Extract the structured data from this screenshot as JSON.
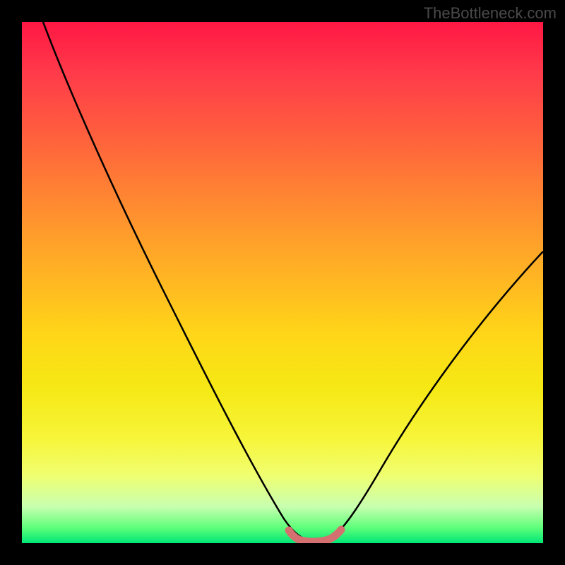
{
  "watermark": "TheBottleneck.com",
  "chart_data": {
    "type": "line",
    "title": "",
    "xlabel": "",
    "ylabel": "",
    "xlim": [
      0,
      100
    ],
    "ylim": [
      0,
      100
    ],
    "background_gradient": {
      "top": "#ff1744",
      "middle": "#ffd618",
      "bottom": "#00e676"
    },
    "series": [
      {
        "name": "curve",
        "color": "#000000",
        "x": [
          4,
          10,
          20,
          30,
          40,
          48,
          52,
          54,
          58,
          60,
          62,
          70,
          80,
          90,
          100
        ],
        "y": [
          100,
          88,
          70,
          52,
          33,
          13,
          4,
          1,
          1,
          2,
          5,
          15,
          30,
          43,
          56
        ]
      },
      {
        "name": "bottom-marker",
        "color": "#d96a6a",
        "x": [
          51,
          53,
          55,
          57,
          59,
          61
        ],
        "y": [
          2,
          0.8,
          0.5,
          0.5,
          1,
          2.5
        ]
      }
    ]
  }
}
